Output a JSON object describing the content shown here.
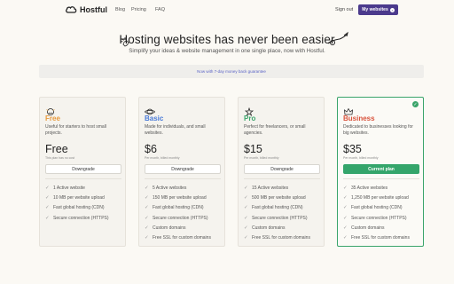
{
  "nav": {
    "brand": "Hostful",
    "links": [
      "Blog",
      "Pricing",
      "FAQ"
    ],
    "signout": "Sign out",
    "cta": "My websites"
  },
  "hero": {
    "title": "Hosting websites has never been easier",
    "subtitle": "Simplify your ideas & website management in one single place, now with Hostful."
  },
  "banner": "Now with 7-day money back guarantee",
  "plans": [
    {
      "name": "Free",
      "color": "#e89a3c",
      "icon": "smiley-icon",
      "desc": "Useful for starters to host small projects.",
      "price": "Free",
      "note": "This plan has no cost",
      "button": "Downgrade",
      "features": [
        "1 Active website",
        "10 MB per website upload",
        "Fast global hosting (CDN)",
        "Secure connection (HTTPS)"
      ]
    },
    {
      "name": "Basic",
      "color": "#4a7bd8",
      "icon": "planet-icon",
      "desc": "Made for individuals, and small websites.",
      "price": "$6",
      "note": "Per month, billed monthly",
      "button": "Downgrade",
      "features": [
        "5 Active websites",
        "150 MB per website upload",
        "Fast global hosting (CDN)",
        "Secure connection (HTTPS)",
        "Custom domains",
        "Free SSL for custom domains"
      ]
    },
    {
      "name": "Pro",
      "color": "#3aa46a",
      "icon": "star-icon",
      "desc": "Perfect for freelancers, or small agencies.",
      "price": "$15",
      "note": "Per month, billed monthly",
      "button": "Downgrade",
      "features": [
        "15 Active websites",
        "500 MB per website upload",
        "Fast global hosting (CDN)",
        "Secure connection (HTTPS)",
        "Custom domains",
        "Free SSL for custom domains"
      ]
    },
    {
      "name": "Business",
      "color": "#d9533c",
      "icon": "crown-icon",
      "desc": "Dedicated to businesses looking for big websites.",
      "price": "$35",
      "note": "Per month, billed monthly",
      "button": "Current plan",
      "features": [
        "35 Active websites",
        "1,250 MB per website upload",
        "Fast global hosting (CDN)",
        "Secure connection (HTTPS)",
        "Custom domains",
        "Free SSL for custom domains"
      ]
    }
  ]
}
